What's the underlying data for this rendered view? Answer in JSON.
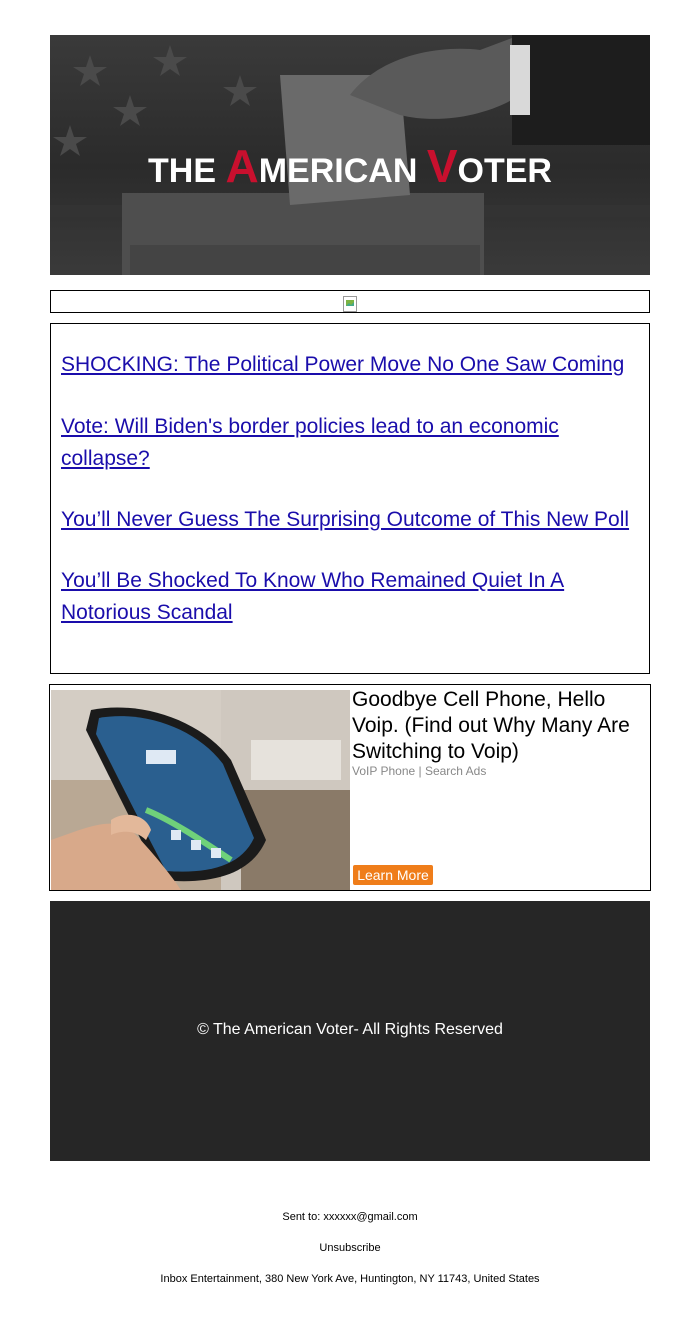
{
  "header": {
    "logo_pre": "THE ",
    "logo_a": "A",
    "logo_merican": "MERICAN ",
    "logo_v": "V",
    "logo_oter": "OTER"
  },
  "links": [
    "SHOCKING: The Political Power Move No One Saw Coming",
    "Vote: Will Biden's border policies lead to an economic collapse?",
    "You’ll Never Guess The Surprising Outcome of This New Poll",
    "You’ll Be Shocked To Know Who Remained Quiet In A Notorious Scandal"
  ],
  "ad": {
    "title": "Goodbye Cell Phone, Hello Voip. (Find out Why Many Are Switching to Voip)",
    "source": "VoIP Phone | Search Ads",
    "button_label": "Learn More"
  },
  "footer": {
    "copyright": "© The American Voter- All Rights Reserved"
  },
  "bottom": {
    "sent_to_label": "Sent to:",
    "sent_to_email": "xxxxxx@gmail.com",
    "unsubscribe": "Unsubscribe",
    "address": "Inbox Entertainment, 380 New York Ave, Huntington, NY 11743, United States"
  },
  "colors": {
    "link": "#1a0dab",
    "brand_red": "#c8102e",
    "button": "#ef7d1a",
    "footer_bg": "#262626"
  }
}
